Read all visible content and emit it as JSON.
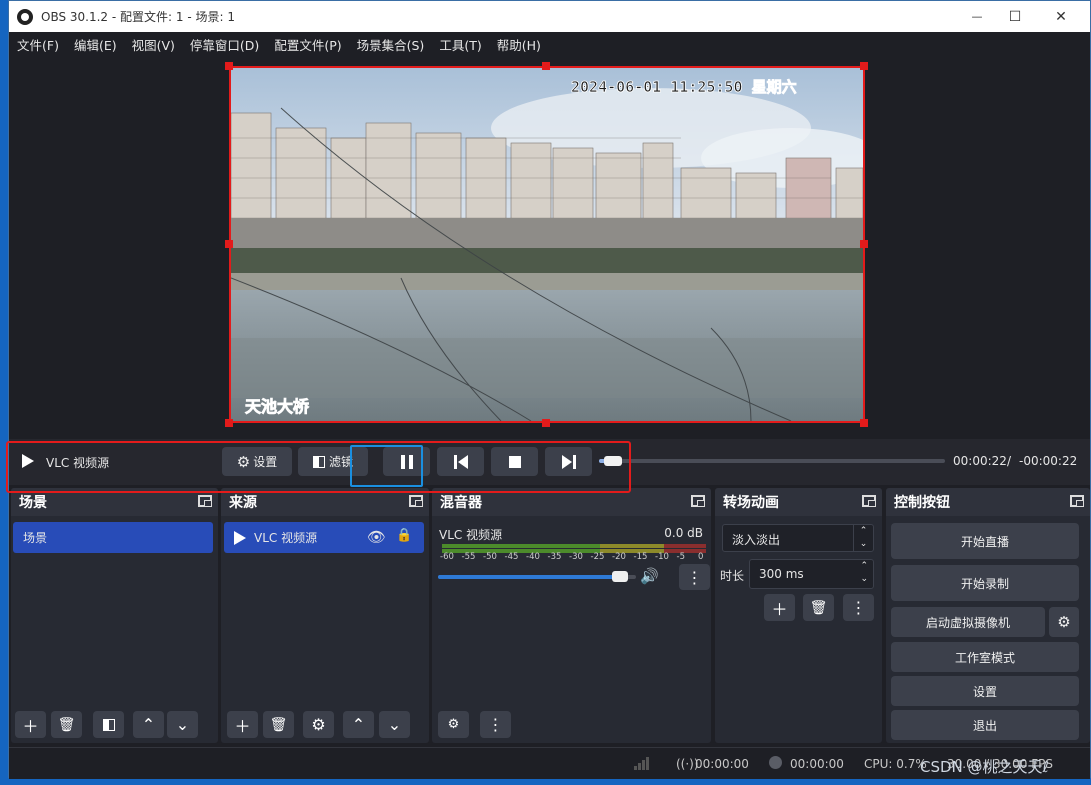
{
  "window": {
    "title": "OBS 30.1.2 - 配置文件: 1 - 场景: 1",
    "controls": {
      "minimize": "—",
      "maximize": "☐",
      "close": "✕"
    }
  },
  "menu": [
    "文件(F)",
    "编辑(E)",
    "视图(V)",
    "停靠窗口(D)",
    "配置文件(P)",
    "场景集合(S)",
    "工具(T)",
    "帮助(H)"
  ],
  "preview": {
    "timestamp": "2024-06-01  11:25:50  星期六",
    "caption": "天池大桥"
  },
  "media_controls": {
    "source_name": "VLC 视频源",
    "settings_label": "设置",
    "filters_label": "滤镜",
    "time_current": "00:00:22",
    "time_separator": "/",
    "time_remaining": "-00:00:22",
    "progress": 0.02
  },
  "docks": {
    "scenes": {
      "title": "场景",
      "items": [
        "场景"
      ]
    },
    "sources": {
      "title": "来源",
      "items": [
        "VLC 视频源"
      ]
    },
    "mixer": {
      "title": "混音器",
      "channel_name": "VLC 视频源",
      "level": "0.0 dB",
      "ticks": [
        "-60",
        "-55",
        "-50",
        "-45",
        "-40",
        "-35",
        "-30",
        "-25",
        "-20",
        "-15",
        "-10",
        "-5",
        "0"
      ],
      "volume": 0.95
    },
    "transitions": {
      "title": "转场动画",
      "selected": "淡入淡出",
      "duration_label": "时长",
      "duration_value": "300 ms"
    },
    "controls": {
      "title": "控制按钮",
      "start_streaming": "开始直播",
      "start_recording": "开始录制",
      "virtual_camera": "启动虚拟摄像机",
      "studio_mode": "工作室模式",
      "settings": "设置",
      "exit": "退出"
    }
  },
  "status": {
    "stream_time": "00:00:00",
    "record_time": "00:00:00",
    "cpu": "CPU: 0.7%",
    "fps": "30.00 / 30.00 FPS"
  },
  "watermark": "CSDN @桃之夭夭ℓ",
  "colors": {
    "accent": "#284cb8",
    "highlight_red": "#e31b1b",
    "highlight_blue": "#1a8fe0"
  }
}
